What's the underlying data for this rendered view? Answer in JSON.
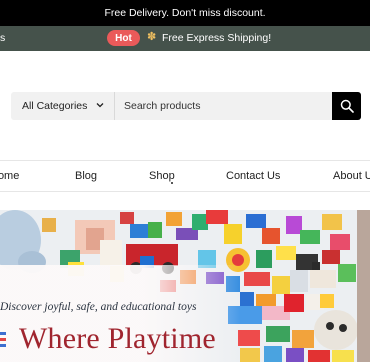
{
  "announcement": {
    "text": "Free Delivery. Don't miss discount."
  },
  "promo": {
    "left_fragment": "s",
    "badge": "Hot",
    "icon": "gift-icon",
    "text": "Free Express Shipping!"
  },
  "search": {
    "category_label": "All Categories",
    "placeholder": "Search products",
    "button_icon": "search-icon"
  },
  "nav": {
    "items": [
      {
        "label": "Home"
      },
      {
        "label": "Blog"
      },
      {
        "label": "Shop"
      },
      {
        "label": "Contact Us"
      },
      {
        "label": "About Us"
      }
    ]
  },
  "hero": {
    "subtitle": "Discover joyful, safe, and educational toys",
    "title": "Where Playtime"
  },
  "colors": {
    "topbar": "#000000",
    "promobar": "#45524b",
    "hot_badge": "#ea5a5a",
    "hero_title": "#a0252f"
  }
}
